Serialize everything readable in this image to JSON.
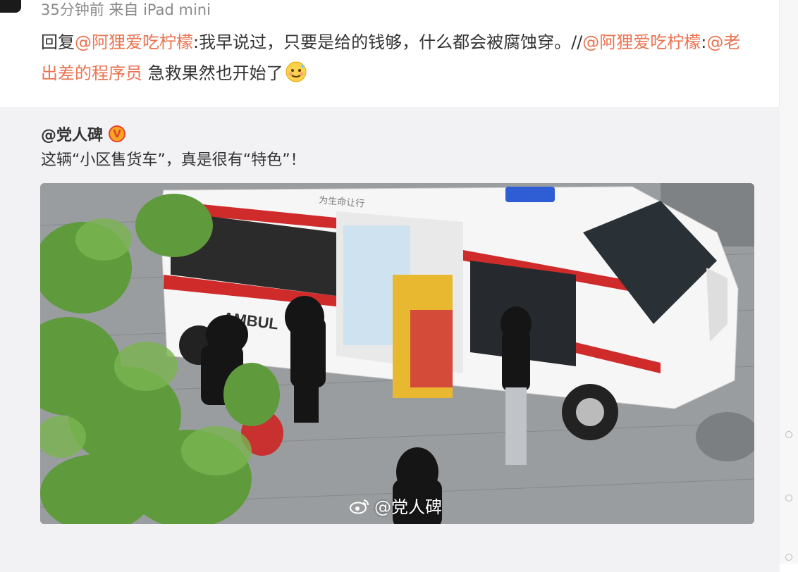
{
  "post": {
    "meta": "35分钟前 来自 iPad mini",
    "reply": {
      "prefix": "回复",
      "mention_1": "@阿狸爱吃柠檬",
      "text_1": ":我早说过，只要是给的钱够，什么都会被腐蚀穿。//",
      "mention_2": "@阿狸爱吃柠檬",
      "sep": ":",
      "mention_3": "@老出差的程序员",
      "text_2": " 急救果然也开始了",
      "emoji": "face-with-sweat-emoji"
    }
  },
  "repost": {
    "author": "@党人碑",
    "verified_label": "V",
    "text": "这辆“小区售货车”，真是很有“特色”！",
    "photo": {
      "ambulance_label": "AMBUL",
      "door_text": "为生命让行",
      "watermark": "@党人碑"
    }
  },
  "colors": {
    "mention": "#eb7350",
    "meta": "#8a8a8a",
    "repost_bg": "#f2f2f5"
  }
}
